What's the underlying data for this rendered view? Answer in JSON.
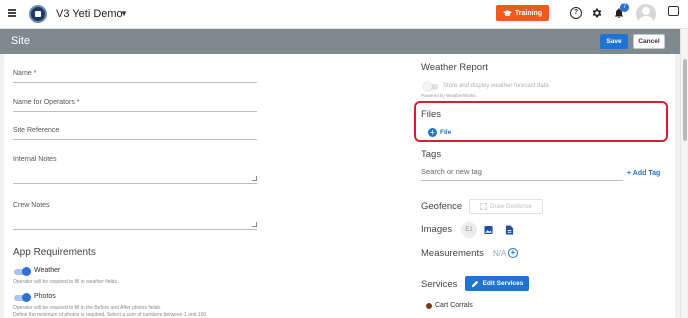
{
  "topbar": {
    "app_title": "V3 Yeti Demo",
    "training_label": "Training",
    "notification_count": "7",
    "colors": {
      "training": "#ef5a1e",
      "primary": "#1f73d1"
    }
  },
  "header": {
    "title": "Site",
    "save_label": "Save",
    "cancel_label": "Cancel"
  },
  "form": {
    "name_label": "Name *",
    "operators_name_label": "Name for Operators *",
    "site_reference_label": "Site Reference",
    "internal_notes_label": "Internal Notes",
    "crew_notes_label": "Crew Notes"
  },
  "app_requirements": {
    "title": "App Requirements",
    "weather_label": "Weather",
    "weather_hint": "Operator will be required to fill in weather fields.",
    "photos_label": "Photos",
    "photos_hint": "Operator will be required to fill in the Before and After photos fields.",
    "photos_hint2": "Define the minimum of photos is required. Select a sum of numbers between 1 and 100."
  },
  "weather_report": {
    "title": "Weather Report",
    "toggle_label": "Store and display weather forecast data",
    "powered_by": "Powered by WeatherWorks"
  },
  "files": {
    "title": "Files",
    "add_label": "File"
  },
  "tags": {
    "title": "Tags",
    "placeholder": "Search or new tag",
    "add_label": "+ Add Tag"
  },
  "geofence": {
    "title": "Geofence",
    "draw_label": "Draw Geofence"
  },
  "images": {
    "title": "Images",
    "placeholder_text": "E1"
  },
  "measurements": {
    "title": "Measurements",
    "value": "N/A"
  },
  "services": {
    "title": "Services",
    "edit_label": "Edit Services",
    "items": [
      "Cart Corrals"
    ]
  }
}
